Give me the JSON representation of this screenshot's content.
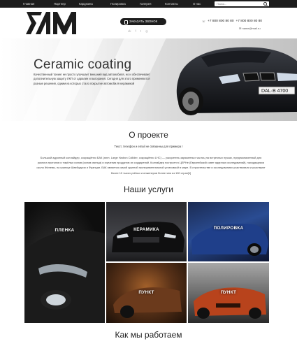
{
  "nav": {
    "items": [
      "Главная",
      "Партнер",
      "Карджина",
      "Полировка",
      "Галерея",
      "Контакты",
      "О нас"
    ]
  },
  "search": {
    "placeholder": "Поиск..."
  },
  "header": {
    "logo_text": "БАМ",
    "call_button": "ЗАКАЗАТЬ ЗВОНОК",
    "phones": [
      "+7 800 800 80 80",
      "+7 800 800 80 80"
    ],
    "email": "name@mail.ru",
    "socials": [
      "vk-icon",
      "facebook-icon",
      "twitter-icon",
      "instagram-icon"
    ]
  },
  "hero": {
    "title": "Ceramic coating",
    "text": "Качественный тонинг не просто улучшает внешний вид автомобиля, но и обеспечивает дополнительную защиту ЛКП от царапин и выгорания. Сегодня для этого применяются разные решения, одним из которых стало покрытие автомобиля керамикой",
    "plate": "DAL·B 4700"
  },
  "about": {
    "title": "О проекте",
    "subtitle": "Текст, телефон и email не связанны для примера !",
    "text": "Большой адронный коллайдер, сокращённо БАК (англ. Large Hadron Collider, сокращённо LHC) — ускоритель заряженных частиц на встречных пучках, предназначенный для разгона протонов и тяжёлых ионов (ионов свинца) и изучения продуктов их соударений. Коллайдер построен в ЦЕРНе (Европейский совет ядерных исследований), находящемся около Женевы, на границе Швейцарии и Франции. БАК является самой крупной экспериментальной установкой в мире. В строительстве и исследованиях участвовали и участвуют более 10 тысяч учёных и инженеров более чем из 100 стран[1]"
  },
  "services": {
    "title": "Наши услуги",
    "tiles": [
      {
        "label": "ПЛЕНКА"
      },
      {
        "label": "КЕРАМИКА"
      },
      {
        "label": "ПОЛИРОВКА"
      },
      {
        "label": "ПУНКТ"
      },
      {
        "label": "ПУНКТ"
      }
    ]
  },
  "how": {
    "title": "Как мы работаем"
  }
}
